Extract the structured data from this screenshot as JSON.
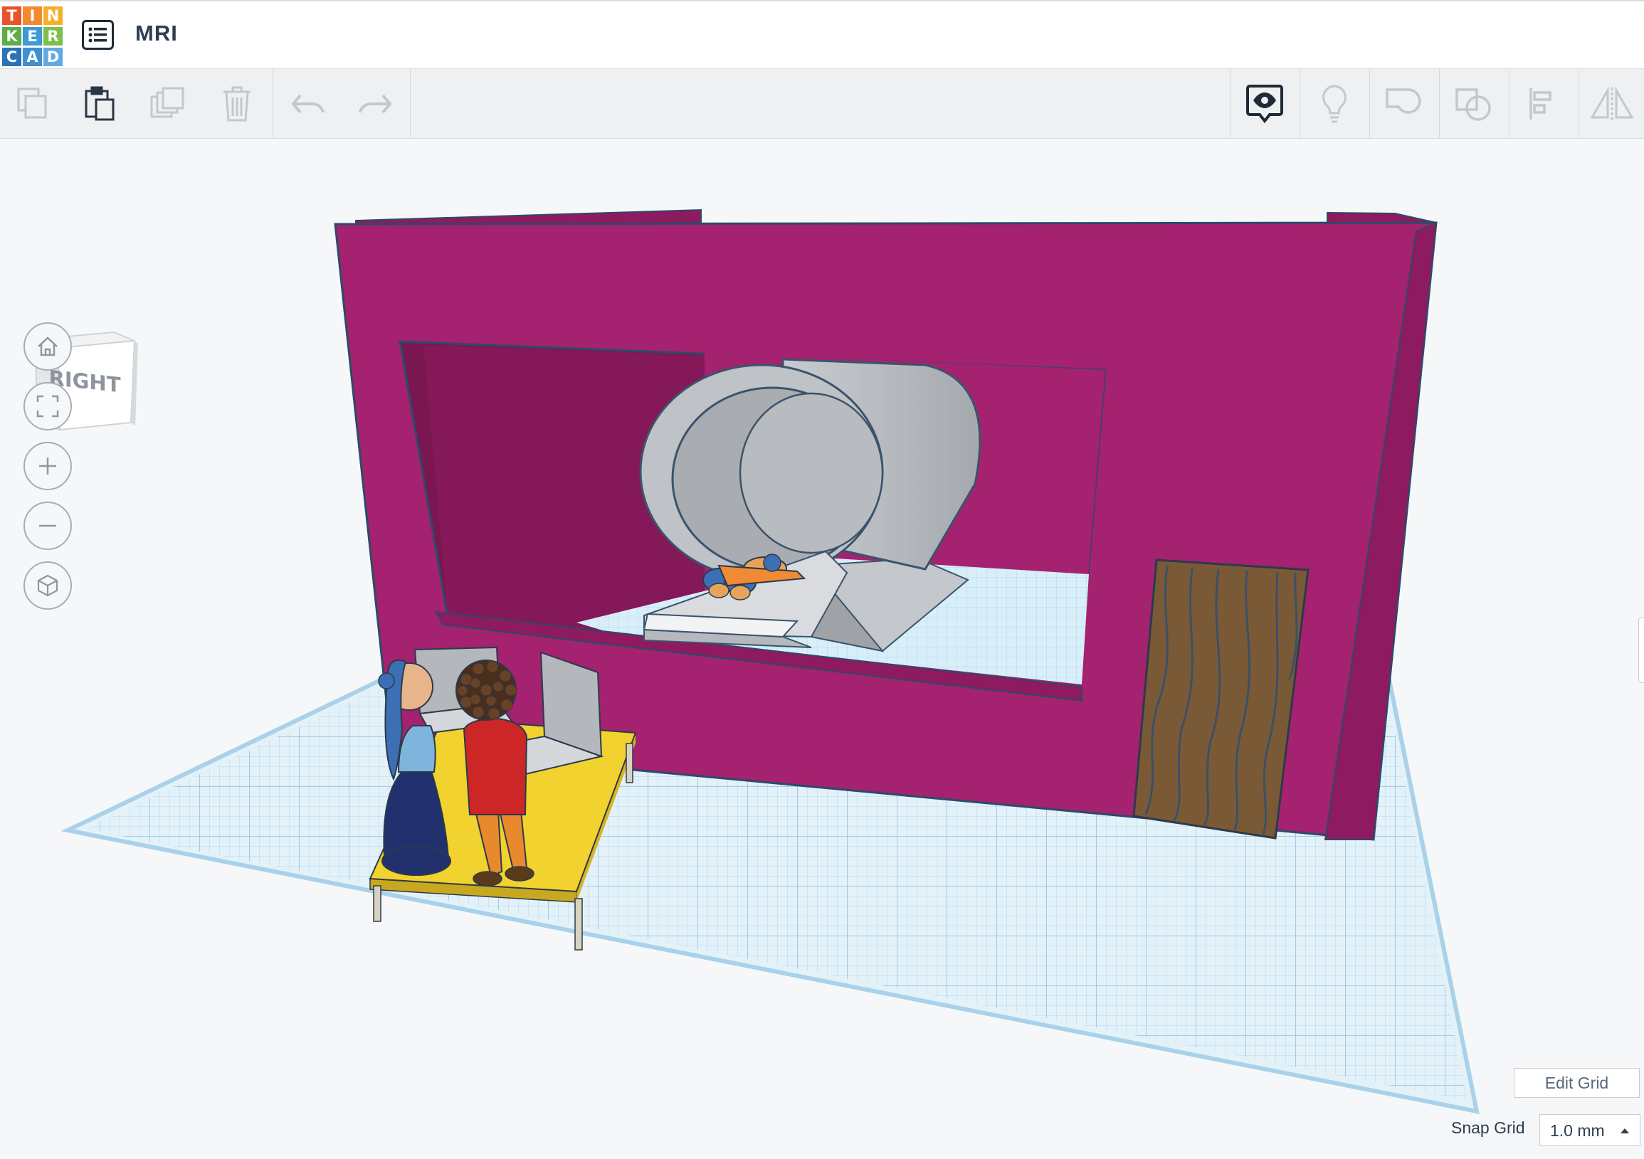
{
  "app": {
    "logo_letters": [
      "T",
      "I",
      "N",
      "K",
      "E",
      "R",
      "C",
      "A",
      "D"
    ],
    "logo_colors": [
      "#e8532b",
      "#f28a2f",
      "#f4b02c",
      "#5cae47",
      "#3e9ad6",
      "#7cc04a",
      "#2b72b8",
      "#3f8fd3",
      "#5fa9e0"
    ],
    "menu_icon": "list-icon",
    "document_title": "MRI"
  },
  "toolbar": {
    "left_tools": [
      {
        "id": "copy",
        "icon": "copy-icon",
        "enabled": false
      },
      {
        "id": "paste",
        "icon": "paste-icon",
        "enabled": true
      },
      {
        "id": "duplicate",
        "icon": "duplicate-icon",
        "enabled": false
      },
      {
        "id": "delete",
        "icon": "trash-icon",
        "enabled": false
      },
      {
        "id": "undo",
        "icon": "undo-icon",
        "enabled": false
      },
      {
        "id": "redo",
        "icon": "redo-icon",
        "enabled": false
      }
    ],
    "right_tools": [
      {
        "id": "notes",
        "icon": "eye-bubble-icon",
        "enabled": true
      },
      {
        "id": "show-all",
        "icon": "lightbulb-icon",
        "enabled": false
      },
      {
        "id": "group",
        "icon": "group-icon",
        "enabled": false
      },
      {
        "id": "ungroup",
        "icon": "ungroup-icon",
        "enabled": false
      },
      {
        "id": "align",
        "icon": "align-icon",
        "enabled": false
      },
      {
        "id": "mirror",
        "icon": "mirror-icon",
        "enabled": false
      }
    ]
  },
  "view_cube": {
    "face_label": "RIGHT"
  },
  "nav_controls": [
    {
      "id": "home",
      "icon": "home-icon"
    },
    {
      "id": "fit",
      "icon": "fit-view-icon"
    },
    {
      "id": "zoom-in",
      "icon": "plus-icon"
    },
    {
      "id": "zoom-out",
      "icon": "minus-icon"
    },
    {
      "id": "ortho",
      "icon": "perspective-cube-icon"
    }
  ],
  "scene": {
    "wall_color": "#a4226f",
    "wall_dark_color": "#7b1750",
    "scanner_color": "#b9bcc0",
    "grid_color": "#cfe7f5",
    "door_color": "#7a5a36"
  },
  "grid_controls": {
    "edit_grid_label": "Edit Grid",
    "snap_grid_label": "Snap Grid",
    "snap_grid_value": "1.0 mm"
  }
}
